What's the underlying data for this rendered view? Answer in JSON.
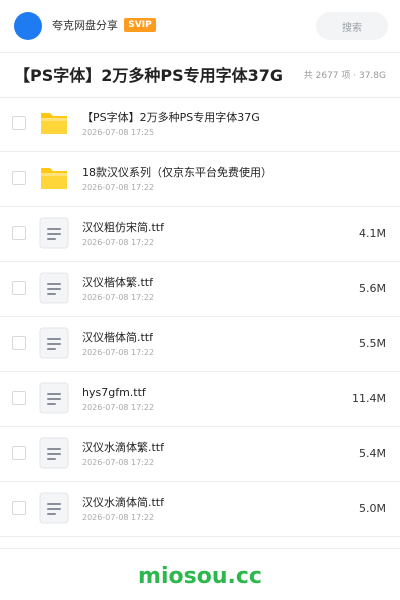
{
  "header": {
    "app_name": "夸克网盘分享",
    "badge": "SVIP",
    "search_placeholder": "搜索",
    "avatar_color": "#1e7bf2",
    "badge_color": "#ff9c1f"
  },
  "title_bar": {
    "title": "【PS字体】2万多种PS专用字体37G",
    "summary": "共 2677 项 · 37.8G"
  },
  "files": [
    {
      "type": "folder",
      "icon": "folder-icon",
      "name": "【PS字体】2万多种PS专用字体37G",
      "date": "2026-07-08 17:25",
      "size": ""
    },
    {
      "type": "folder",
      "icon": "folder-icon",
      "name": "18款汉仪系列（仅京东平台免费使用）",
      "date": "2026-07-08 17:22",
      "size": ""
    },
    {
      "type": "file",
      "icon": "document-icon",
      "name": "汉仪粗仿宋简.ttf",
      "date": "2026-07-08 17:22",
      "size": "4.1M"
    },
    {
      "type": "file",
      "icon": "document-icon",
      "name": "汉仪楷体繁.ttf",
      "date": "2026-07-08 17:22",
      "size": "5.6M"
    },
    {
      "type": "file",
      "icon": "document-icon",
      "name": "汉仪楷体简.ttf",
      "date": "2026-07-08 17:22",
      "size": "5.5M"
    },
    {
      "type": "file",
      "icon": "document-icon",
      "name": "hys7gfm.ttf",
      "date": "2026-07-08 17:22",
      "size": "11.4M"
    },
    {
      "type": "file",
      "icon": "document-icon",
      "name": "汉仪水滴体繁.ttf",
      "date": "2026-07-08 17:22",
      "size": "5.4M"
    },
    {
      "type": "file",
      "icon": "document-icon",
      "name": "汉仪水滴体简.ttf",
      "date": "2026-07-08 17:22",
      "size": "5.0M"
    }
  ],
  "footer": {
    "brand": "miosou.cc",
    "brand_color": "#2db84d"
  }
}
